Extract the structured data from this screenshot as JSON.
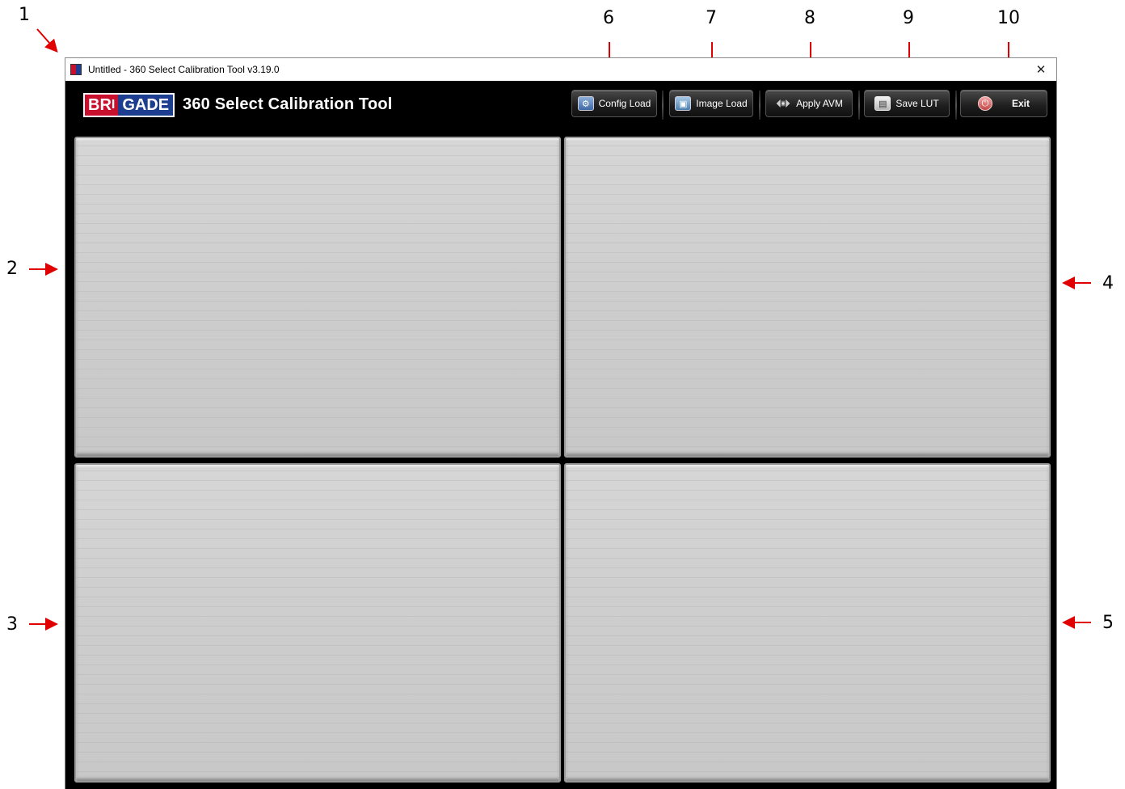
{
  "window": {
    "title": "Untitled - 360 Select Calibration Tool v3.19.0",
    "close_glyph": "✕"
  },
  "header": {
    "logo_left": "BR",
    "logo_right": "GADE",
    "logo_mark": "I",
    "app_name": "360 Select Calibration Tool"
  },
  "toolbar": {
    "buttons": [
      {
        "label": "Config Load",
        "icon": "config-icon"
      },
      {
        "label": "Image Load",
        "icon": "image-icon"
      },
      {
        "label": "Apply AVM",
        "icon": "apply-icon"
      },
      {
        "label": "Save LUT",
        "icon": "save-icon"
      },
      {
        "label": "Exit",
        "icon": "exit-icon"
      }
    ]
  },
  "callouts": [
    "1",
    "2",
    "3",
    "4",
    "5",
    "6",
    "7",
    "8",
    "9",
    "10"
  ],
  "colors": {
    "brand_red": "#c8102e",
    "brand_blue": "#1d3d8f",
    "arrow_red": "#e00000",
    "panel_gray": "#d0d0d0"
  }
}
